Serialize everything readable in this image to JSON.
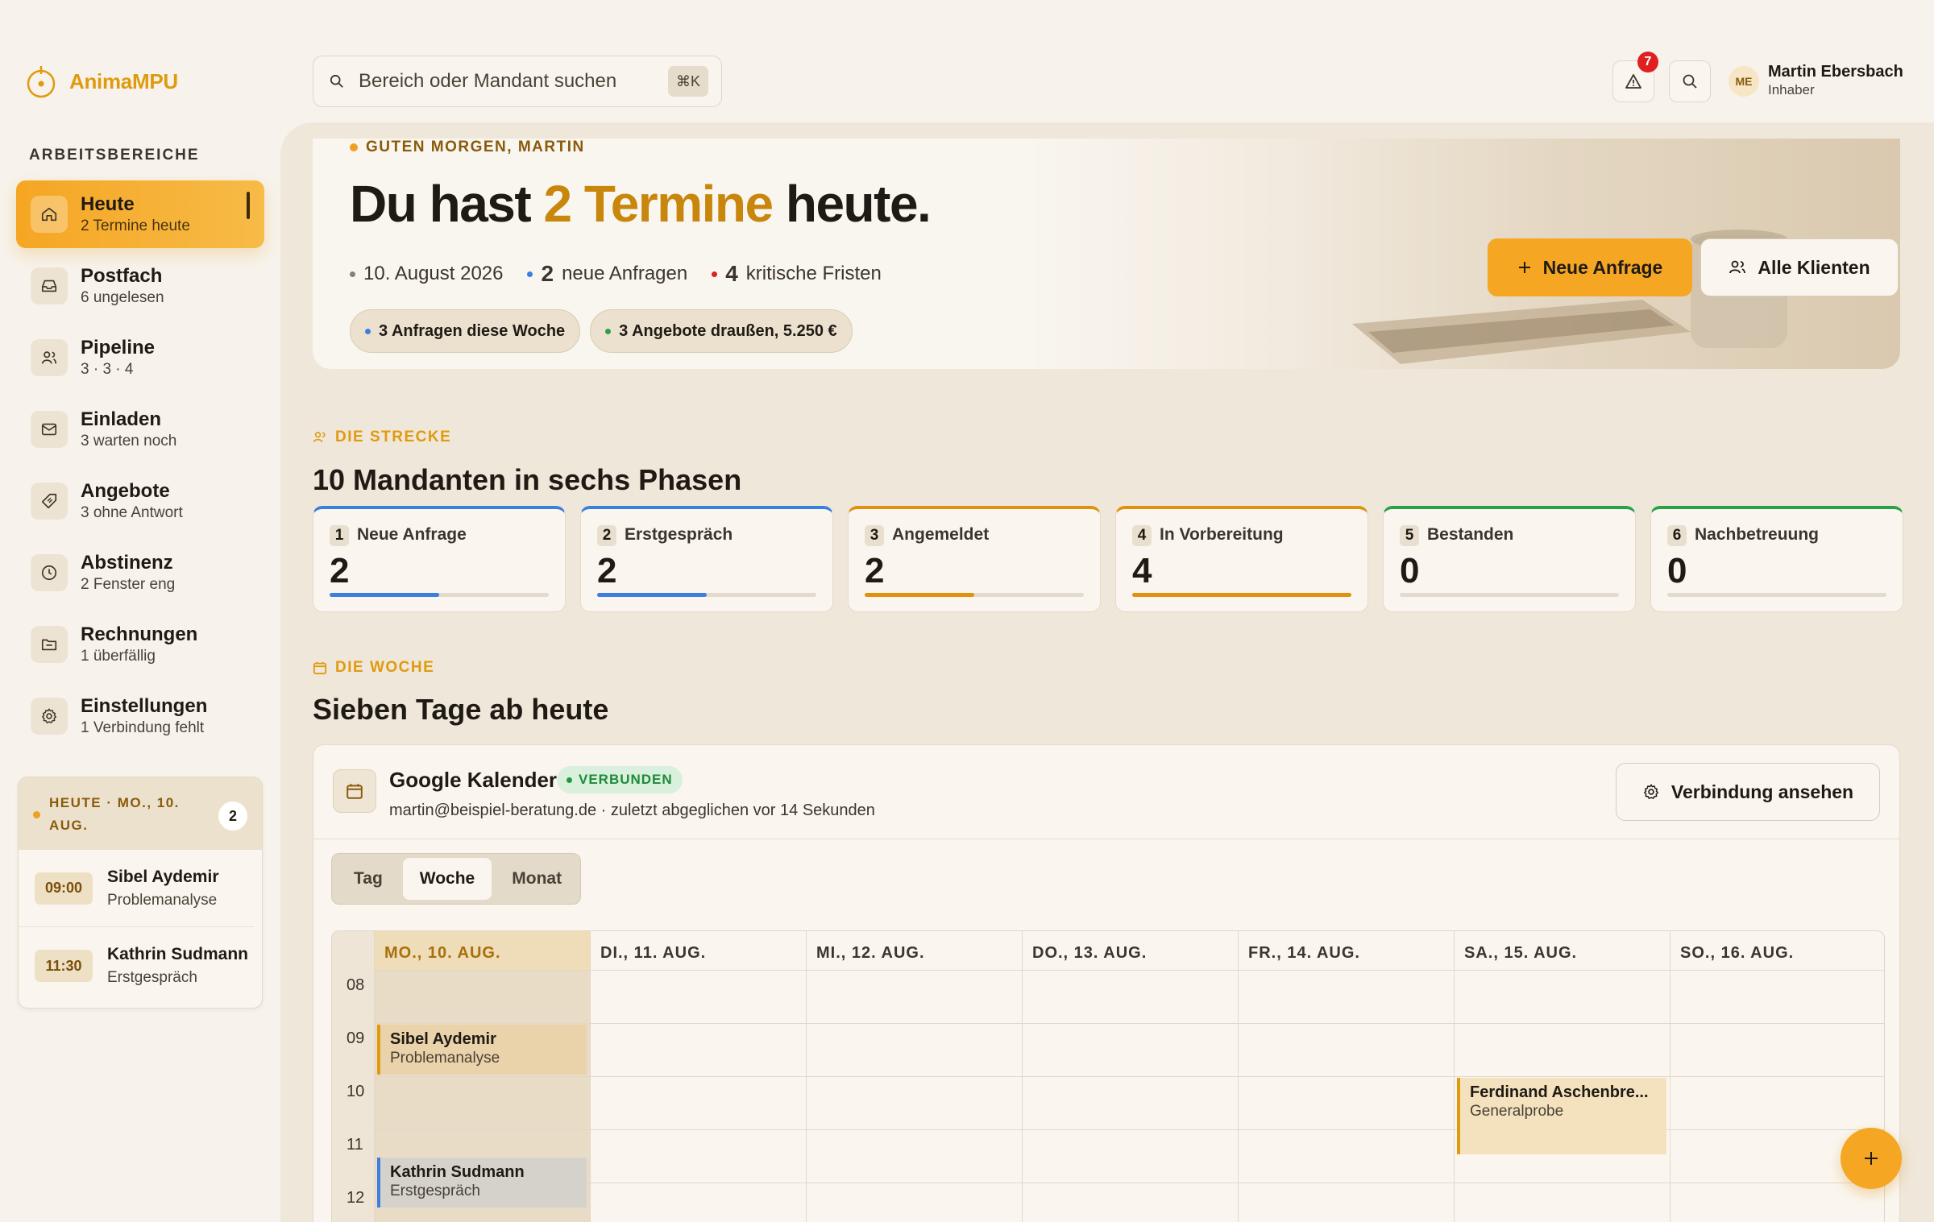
{
  "app": {
    "name": "AnimaMPU"
  },
  "sidebar": {
    "section_label": "ARBEITSBEREICHE",
    "items": [
      {
        "label": "Heute",
        "sub": "2 Termine heute",
        "icon": "home-icon"
      },
      {
        "label": "Postfach",
        "sub": "6 ungelesen",
        "icon": "inbox-icon"
      },
      {
        "label": "Pipeline",
        "sub": "3 · 3 · 4",
        "icon": "users-icon"
      },
      {
        "label": "Einladen",
        "sub": "3 warten noch",
        "icon": "mail-icon"
      },
      {
        "label": "Angebote",
        "sub": "3 ohne Antwort",
        "icon": "tag-icon"
      },
      {
        "label": "Abstinenz",
        "sub": "2 Fenster eng",
        "icon": "clock-icon"
      },
      {
        "label": "Rechnungen",
        "sub": "1 überfällig",
        "icon": "folder-icon"
      },
      {
        "label": "Einstellungen",
        "sub": "1 Verbindung fehlt",
        "icon": "gear-icon"
      }
    ],
    "today_card": {
      "label": "HEUTE · MO., 10. AUG.",
      "count": "2",
      "appointments": [
        {
          "time": "09:00",
          "name": "Sibel Aydemir",
          "type": "Problemanalyse"
        },
        {
          "time": "11:30",
          "name": "Kathrin Sudmann",
          "type": "Erstgespräch"
        }
      ]
    }
  },
  "topbar": {
    "search_placeholder": "Bereich oder Mandant suchen",
    "shortcut": "⌘K",
    "alerts_count": "7",
    "user": {
      "initials": "ME",
      "name": "Martin Ebersbach",
      "role": "Inhaber"
    }
  },
  "hero": {
    "greeting": "GUTEN MORGEN, MARTIN",
    "title_pre": "Du hast ",
    "title_highlight": "2 Termine",
    "title_post": " heute.",
    "date": "10. August 2026",
    "new_count": "2",
    "new_label": "neue Anfragen",
    "critical_count": "4",
    "critical_label": "kritische Fristen",
    "chips": [
      "3 Anfragen diese Woche",
      "3 Angebote draußen, 5.250 €"
    ],
    "primary_button": "Neue Anfrage",
    "secondary_button": "Alle Klienten"
  },
  "pipeline": {
    "kicker": "DIE STRECKE",
    "title": "10 Mandanten in sechs Phasen",
    "phases": [
      {
        "num": "1",
        "label": "Neue Anfrage",
        "value": "2",
        "progress": 0.5,
        "color": "#3b7fe0"
      },
      {
        "num": "2",
        "label": "Erstgespräch",
        "value": "2",
        "progress": 0.5,
        "color": "#3b7fe0"
      },
      {
        "num": "3",
        "label": "Angemeldet",
        "value": "2",
        "progress": 0.5,
        "color": "#e0920e"
      },
      {
        "num": "4",
        "label": "In Vorbereitung",
        "value": "4",
        "progress": 1.0,
        "color": "#e0920e"
      },
      {
        "num": "5",
        "label": "Bestanden",
        "value": "0",
        "progress": 0,
        "color": "#2aa24a"
      },
      {
        "num": "6",
        "label": "Nachbetreuung",
        "value": "0",
        "progress": 0,
        "color": "#2aa24a"
      }
    ]
  },
  "week": {
    "kicker": "DIE WOCHE",
    "title": "Sieben Tage ab heute",
    "calendar": {
      "name": "Google Kalender",
      "status": "VERBUNDEN",
      "account": "martin@beispiel-beratung.de · zuletzt abgeglichen vor 14 Sekunden",
      "button": "Verbindung ansehen"
    },
    "views": [
      "Tag",
      "Woche",
      "Monat"
    ],
    "active_view": "Woche",
    "days": [
      "MO., 10. AUG.",
      "DI., 11. AUG.",
      "MI., 12. AUG.",
      "DO., 13. AUG.",
      "FR., 14. AUG.",
      "SA., 15. AUG.",
      "SO., 16. AUG."
    ],
    "hours": [
      "08",
      "09",
      "10",
      "11",
      "12"
    ],
    "events": [
      {
        "name": "Sibel Aydemir",
        "type": "Problemanalyse",
        "day": 0,
        "start": "09:00",
        "end": "10:00",
        "color": "#e09a0e",
        "bg": "#ead3aa"
      },
      {
        "name": "Kathrin Sudmann",
        "type": "Erstgespräch",
        "day": 0,
        "start": "11:30",
        "end": "12:30",
        "color": "#3b7fe0",
        "bg": "#d5d2cc"
      },
      {
        "name": "Ferdinand Aschenbre...",
        "type": "Generalprobe",
        "day": 5,
        "start": "10:00",
        "end": "11:30",
        "color": "#e09a0e",
        "bg": "#f4e2bf"
      }
    ]
  }
}
